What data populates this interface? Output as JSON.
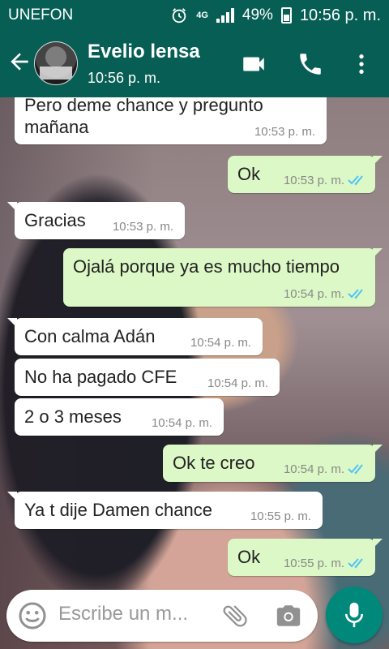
{
  "status_bar": {
    "carrier": "UNEFON",
    "network": "4G",
    "battery": "49%",
    "time": "10:56 p. m."
  },
  "header": {
    "contact_name": "Evelio lensa",
    "last_seen": "10:56 p. m.",
    "icons": [
      "back-arrow-icon",
      "video-call-icon",
      "phone-call-icon",
      "more-options-icon"
    ]
  },
  "messages": [
    {
      "dir": "in",
      "text": "Pero deme chance y pregunto\nmañana",
      "time": "10:53 p. m."
    },
    {
      "dir": "out",
      "text": "Ok",
      "time": "10:53 p. m.",
      "ticks": "read"
    },
    {
      "dir": "in",
      "text": "Gracias",
      "time": "10:53 p. m."
    },
    {
      "dir": "out",
      "text": "Ojalá porque ya es mucho tiempo",
      "time": "10:54 p. m.",
      "ticks": "read"
    },
    {
      "dir": "in",
      "text": "Con calma Adán",
      "time": "10:54 p. m."
    },
    {
      "dir": "in",
      "text": "No ha pagado CFE",
      "time": "10:54 p. m."
    },
    {
      "dir": "in",
      "text": "2 o 3 meses",
      "time": "10:54 p. m."
    },
    {
      "dir": "out",
      "text": "Ok te creo",
      "time": "10:54 p. m.",
      "ticks": "read"
    },
    {
      "dir": "in",
      "text": "Ya t dije Damen chance",
      "time": "10:55 p. m."
    },
    {
      "dir": "out",
      "text": "Ok",
      "time": "10:55 p. m.",
      "ticks": "read"
    }
  ],
  "input": {
    "placeholder": "Escribe un m..."
  },
  "colors": {
    "header": "#075e54",
    "incoming": "#ffffff",
    "outgoing": "#dcf8c6",
    "read_ticks": "#4fc3f7",
    "mic_button": "#00897b"
  }
}
